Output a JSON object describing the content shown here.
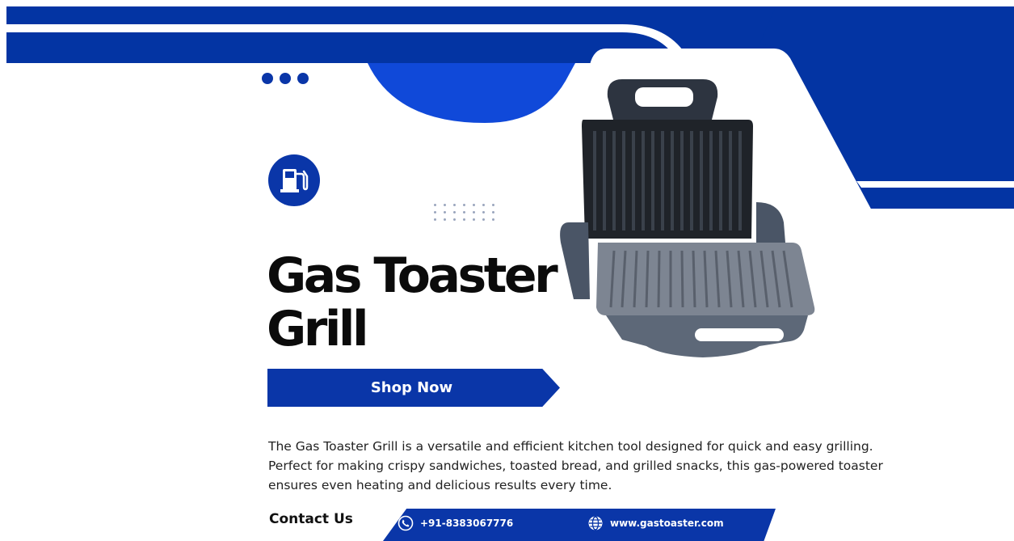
{
  "colors": {
    "brand_blue": "#0a36a8",
    "deep_blue": "#0334a3",
    "text_dark": "#0b0b0b"
  },
  "hero": {
    "title_line1": "Gas Toaster",
    "title_line2": "Grill"
  },
  "cta": {
    "label": "Shop Now"
  },
  "description": "The Gas Toaster Grill is a versatile and efficient kitchen tool designed for quick and easy grilling. Perfect for making crispy sandwiches, toasted bread, and grilled snacks, this gas-powered toaster ensures even heating and delicious results every time.",
  "contact": {
    "label": "Contact Us",
    "phone": "+91-8383067776",
    "website": "www.gastoaster.com"
  },
  "icons": {
    "badge": "fuel-pump-icon",
    "phone": "phone-icon",
    "web": "globe-icon",
    "dots": "three-dots-icon"
  }
}
